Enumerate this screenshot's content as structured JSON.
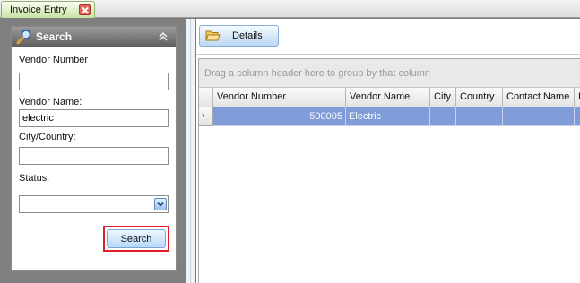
{
  "tab": {
    "title": "Invoice Entry"
  },
  "search_panel": {
    "title": "Search",
    "vendor_number": {
      "label": "Vendor Number",
      "value": ""
    },
    "vendor_name": {
      "label": "Vendor Name:",
      "value": "electric"
    },
    "city_country": {
      "label": "City/Country:",
      "value": ""
    },
    "status": {
      "label": "Status:",
      "value": ""
    },
    "search_button": "Search"
  },
  "toolbar": {
    "details_button": "Details"
  },
  "grid": {
    "group_hint": "Drag a column header here to group by that column",
    "columns": [
      "Vendor Number",
      "Vendor Name",
      "City",
      "Country",
      "Contact Name",
      "P"
    ],
    "rows": [
      {
        "vendor_number": "500005",
        "vendor_name": "Electric",
        "city": "",
        "country": "",
        "contact_name": "",
        "p": ""
      }
    ],
    "row_indicator": "›"
  },
  "colors": {
    "selected_row": "#7f9bd8",
    "highlight_border": "#e01e2a",
    "tab_active": "#c9e3a4"
  }
}
